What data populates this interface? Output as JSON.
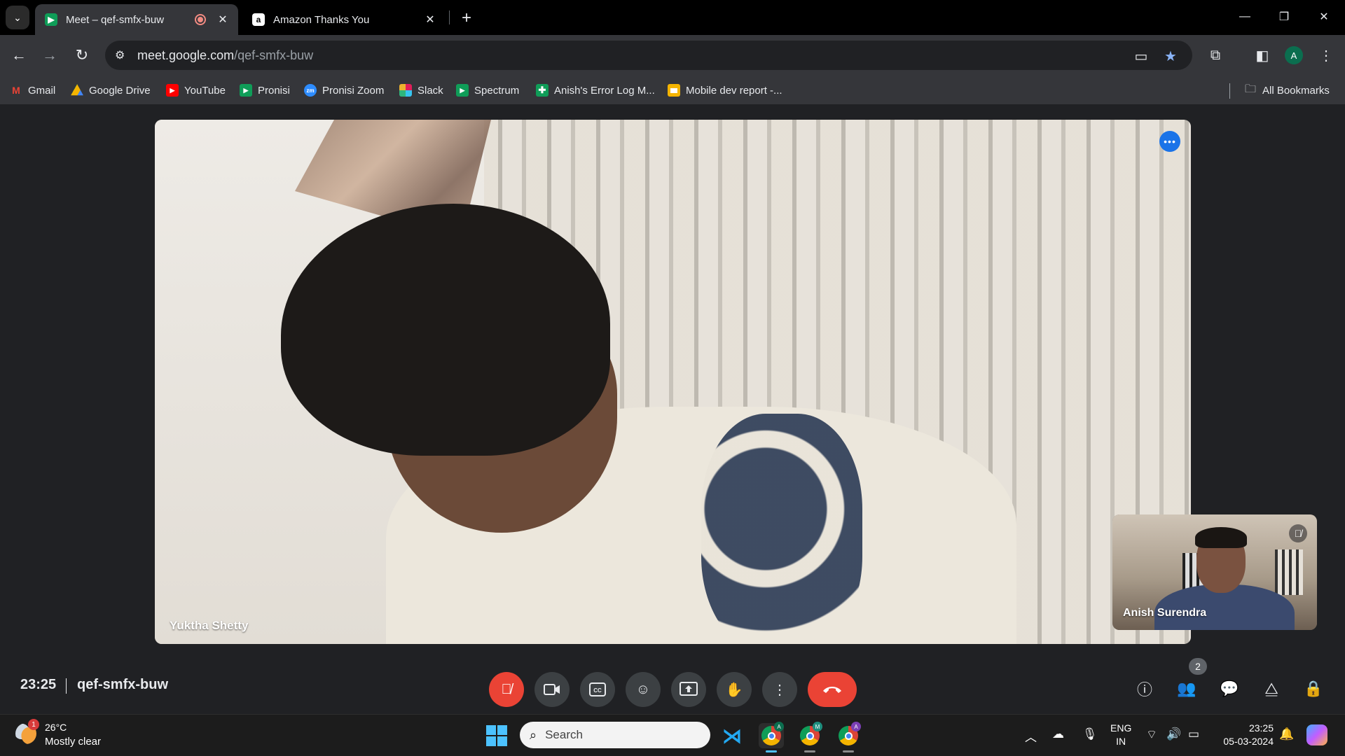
{
  "browser": {
    "tabs": [
      {
        "title": "Meet – qef-smfx-buw",
        "active": true
      },
      {
        "title": "Amazon Thanks You",
        "active": false
      }
    ],
    "url_host": "meet.google.com",
    "url_path": "/qef-smfx-buw",
    "profile_initial": "A",
    "bookmarks": [
      {
        "label": "Gmail",
        "icon": "gmail-icon"
      },
      {
        "label": "Google Drive",
        "icon": "drive-icon"
      },
      {
        "label": "YouTube",
        "icon": "youtube-icon"
      },
      {
        "label": "Pronisi",
        "icon": "meet-icon"
      },
      {
        "label": "Pronisi Zoom",
        "icon": "zoom-icon"
      },
      {
        "label": "Slack",
        "icon": "slack-icon"
      },
      {
        "label": "Spectrum",
        "icon": "meet-icon"
      },
      {
        "label": "Anish's Error Log M...",
        "icon": "sheets-icon"
      },
      {
        "label": "Mobile dev report -...",
        "icon": "slides-icon"
      }
    ],
    "all_bookmarks_label": "All Bookmarks"
  },
  "meet": {
    "main_participant": "Yuktha Shetty",
    "self_participant": "Anish Surendra",
    "time": "23:25",
    "meeting_code": "qef-smfx-buw",
    "people_count": "2"
  },
  "taskbar": {
    "weather_temp": "26°C",
    "weather_desc": "Mostly clear",
    "weather_badge": "1",
    "search_placeholder": "Search",
    "lang_line1": "ENG",
    "lang_line2": "IN",
    "clock_time": "23:25",
    "clock_date": "05-03-2024",
    "chrome_badges": [
      "A",
      "M",
      "A"
    ]
  },
  "colors": {
    "accent_red": "#ea4335",
    "accent_blue": "#1a73e8",
    "surface": "#202124"
  }
}
